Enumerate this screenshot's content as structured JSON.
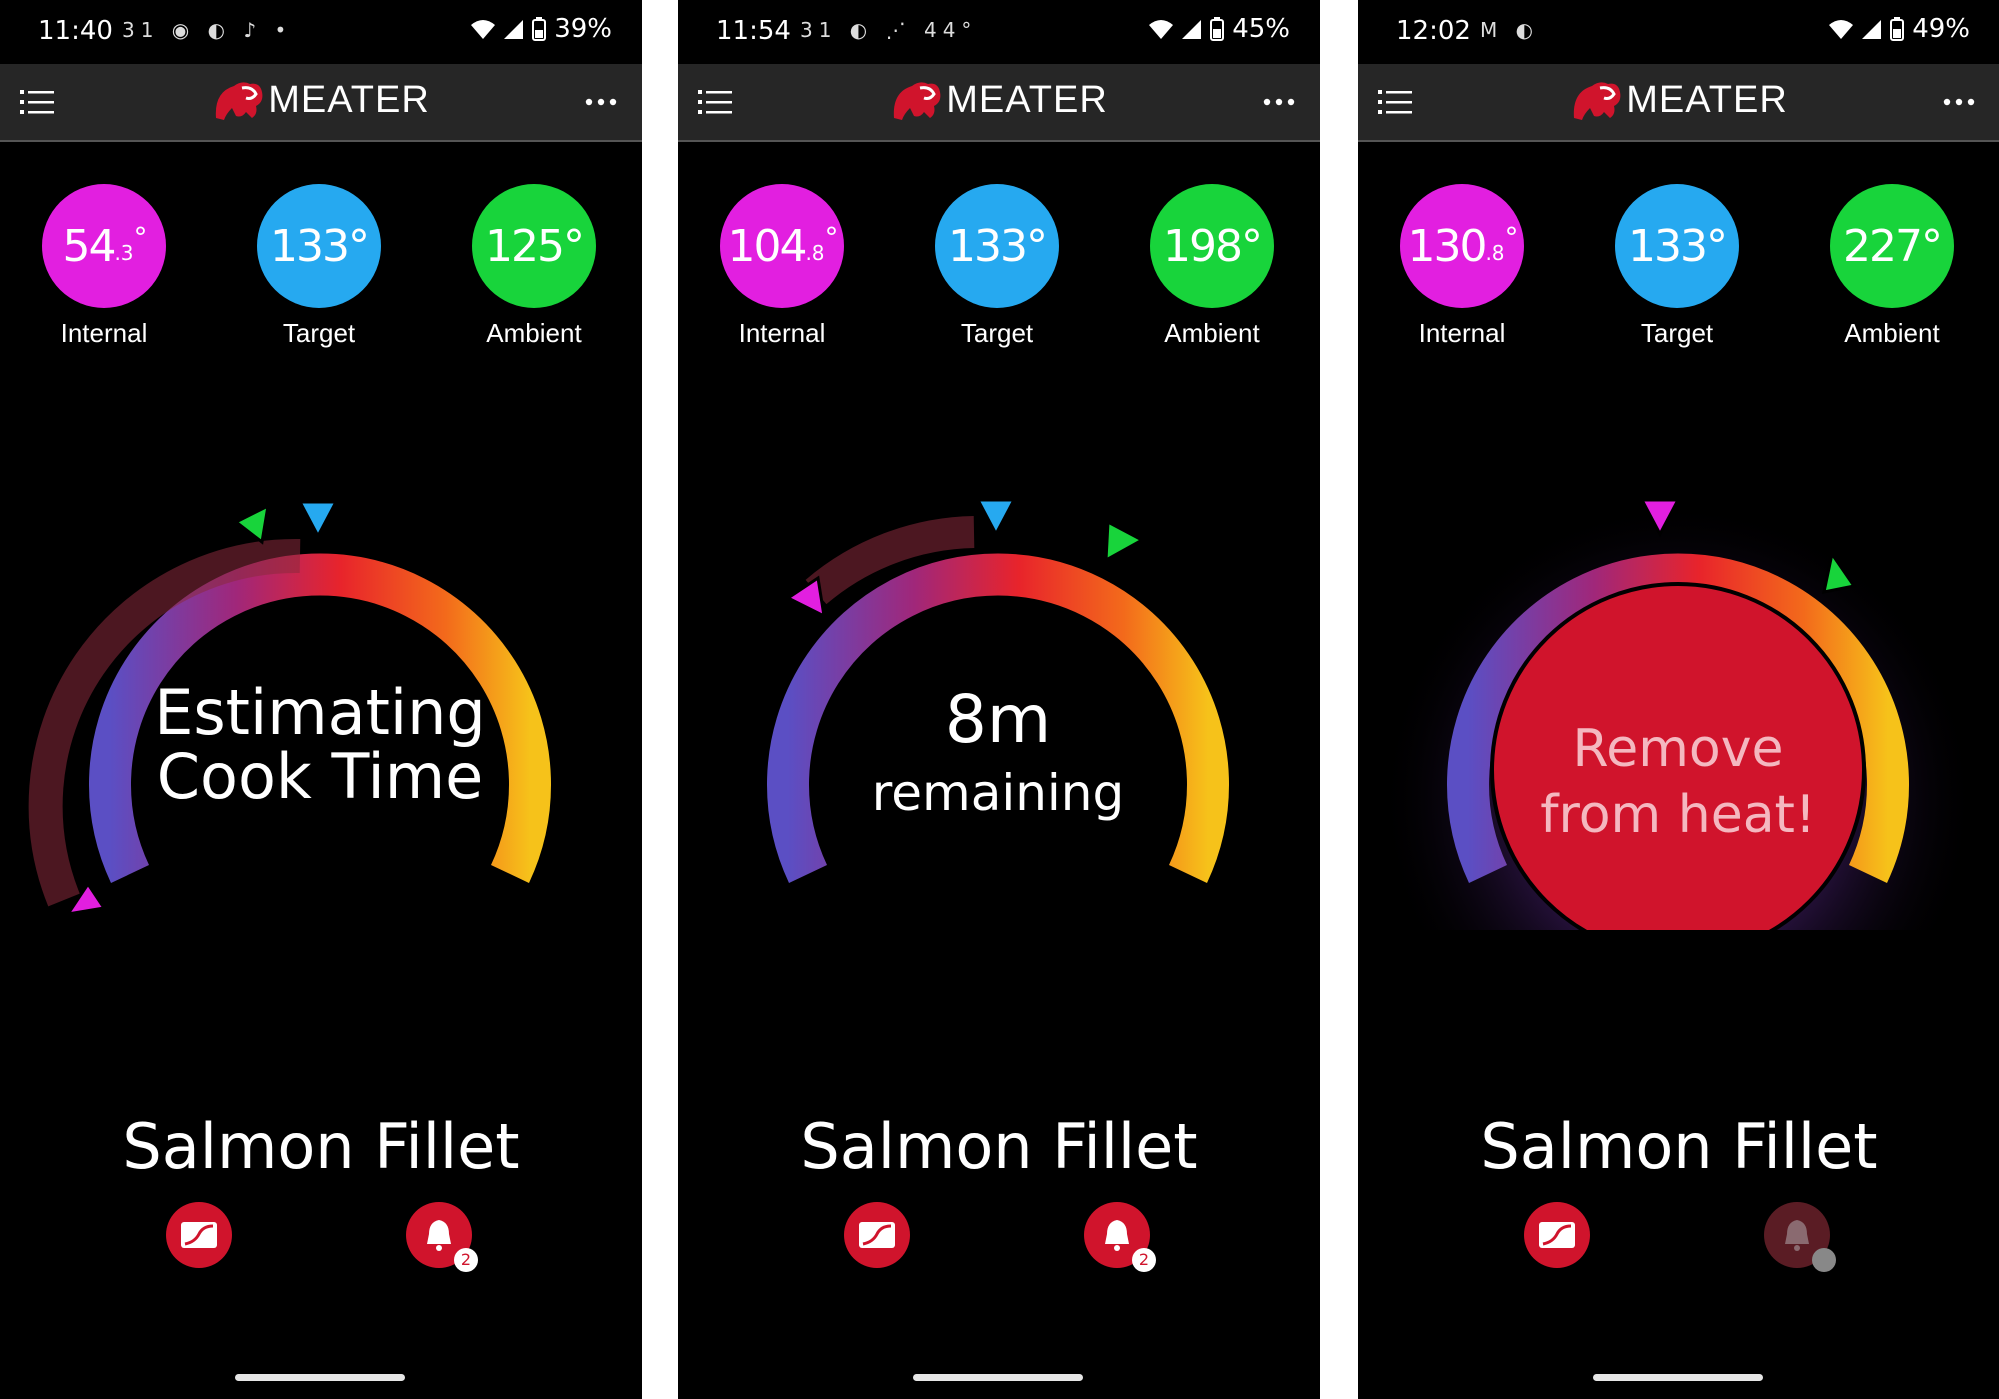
{
  "app": {
    "logo_text": "MEATER"
  },
  "colors": {
    "internal": "#e21fe0",
    "target": "#26a9f0",
    "ambient": "#18d43b",
    "alert": "#d0142c"
  },
  "labels": {
    "internal": "Internal",
    "target": "Target",
    "ambient": "Ambient"
  },
  "icons": {
    "menu": "menu-icon",
    "more": "more-icon",
    "graph": "graph-icon",
    "bell": "bell-icon"
  },
  "screens": [
    {
      "status": {
        "time": "11:40",
        "icons": "31 ◉ ◐ ♪ •",
        "battery": "39%"
      },
      "internal": {
        "whole": "54",
        "decimal": ".3",
        "deg": "°"
      },
      "target": "133°",
      "ambient": "125°",
      "center": {
        "line1": "Estimating",
        "line2": "Cook Time"
      },
      "food": "Salmon Fillet",
      "alerts_badge": "2",
      "progress": {
        "internal": 0.0,
        "ambient": 0.46,
        "target": 0.54
      }
    },
    {
      "status": {
        "time": "11:54",
        "icons": "31 ◐ ⋰ 44°",
        "battery": "45%"
      },
      "internal": {
        "whole": "104",
        "decimal": ".8",
        "deg": "°"
      },
      "target": "133°",
      "ambient": "198°",
      "center": {
        "line1": "8m",
        "line2": "remaining"
      },
      "food": "Salmon Fillet",
      "alerts_badge": "2",
      "progress": {
        "internal": 0.2,
        "target": 0.52,
        "ambient": 0.68
      }
    },
    {
      "status": {
        "time": "12:02",
        "icons": "M ◐",
        "battery": "49%"
      },
      "internal": {
        "whole": "130",
        "decimal": ".8",
        "deg": "°"
      },
      "target": "133°",
      "ambient": "227°",
      "center": {
        "line1": "Remove",
        "line2": "from heat!"
      },
      "food": "Salmon Fillet",
      "alerts_badge": "",
      "progress": {
        "internal": 0.47,
        "ambient": 0.7
      }
    }
  ]
}
